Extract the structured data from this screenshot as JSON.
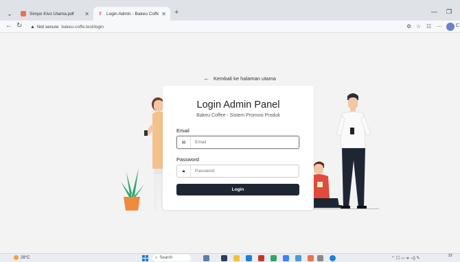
{
  "browser": {
    "tabs": [
      {
        "title": "Simpo Kivo Utama.pdf",
        "active": false
      },
      {
        "title": "Login Admin - Bakeu Coffee",
        "active": true
      }
    ],
    "address": {
      "security": "Not secure",
      "url": "bakeu-coffe.test/login"
    }
  },
  "page": {
    "back_link": "Kembali ke halaman utama",
    "title": "Login Admin Panel",
    "subtitle": "Bakeu Coffee - Sistem Promosi Produk",
    "email_label": "Email",
    "email_placeholder": "Email",
    "password_label": "Password",
    "password_placeholder": "Password",
    "login_button": "Login"
  },
  "taskbar": {
    "weather": "28°C",
    "search": "Search",
    "clock_time": "23",
    "clock_date": ""
  },
  "colors": {
    "button": "#1f2633",
    "shirt_red": "#e24a3b",
    "plant_green": "#2fa56c",
    "pot_orange": "#f08a3c",
    "accent_blue": "#1e7fd8"
  }
}
